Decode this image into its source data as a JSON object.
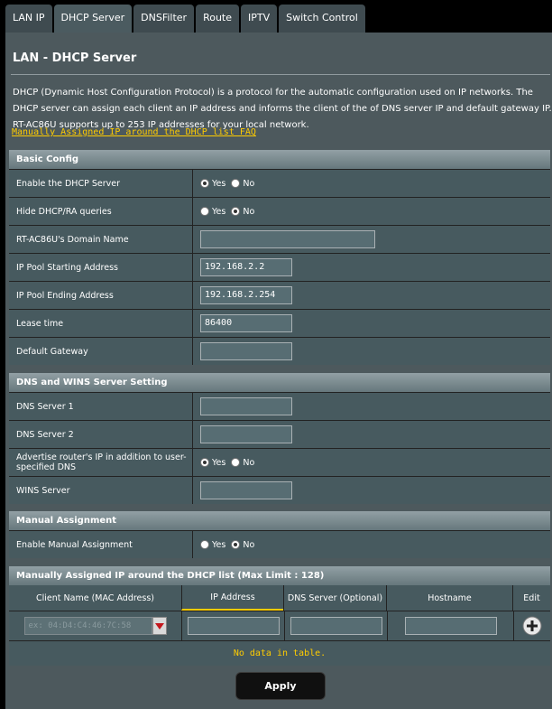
{
  "tabs": [
    {
      "label": "LAN IP"
    },
    {
      "label": "DHCP Server"
    },
    {
      "label": "DNSFilter"
    },
    {
      "label": "Route"
    },
    {
      "label": "IPTV"
    },
    {
      "label": "Switch Control"
    }
  ],
  "page": {
    "title": "LAN - DHCP Server",
    "description": "DHCP (Dynamic Host Configuration Protocol) is a protocol for the automatic configuration used on IP networks. The DHCP server can assign each client an IP address and informs the client of the of DNS server IP and default gateway IP. RT-AC86U supports up to 253 IP addresses for your local network.",
    "faq_link": "Manually Assigned IP around the DHCP list FAQ"
  },
  "radio": {
    "yes": "Yes",
    "no": "No"
  },
  "basic": {
    "header": "Basic Config",
    "enable_dhcp": {
      "label": "Enable the DHCP Server",
      "value": "Yes"
    },
    "hide_dhcp": {
      "label": "Hide DHCP/RA queries",
      "value": "No"
    },
    "domain": {
      "label": "RT-AC86U's Domain Name",
      "value": ""
    },
    "pool_start": {
      "label": "IP Pool Starting Address",
      "value": "192.168.2.2"
    },
    "pool_end": {
      "label": "IP Pool Ending Address",
      "value": "192.168.2.254"
    },
    "lease": {
      "label": "Lease time",
      "value": "86400"
    },
    "gateway": {
      "label": "Default Gateway",
      "value": ""
    }
  },
  "dns": {
    "header": "DNS and WINS Server Setting",
    "dns1": {
      "label": "DNS Server 1",
      "value": ""
    },
    "dns2": {
      "label": "DNS Server 2",
      "value": ""
    },
    "advertise": {
      "label": "Advertise router's IP in addition to user-specified DNS",
      "value": "Yes"
    },
    "wins": {
      "label": "WINS Server",
      "value": ""
    }
  },
  "manual": {
    "header": "Manual Assignment",
    "enable": {
      "label": "Enable Manual Assignment",
      "value": "No"
    }
  },
  "list": {
    "header": "Manually Assigned IP around the DHCP list (Max Limit : 128)",
    "columns": [
      "Client Name (MAC Address)",
      "IP Address",
      "DNS Server (Optional)",
      "Hostname",
      "Edit"
    ],
    "mac_placeholder": "ex: 04:D4:C4:46:7C:58",
    "empty": "No data in table."
  },
  "apply_label": "Apply"
}
